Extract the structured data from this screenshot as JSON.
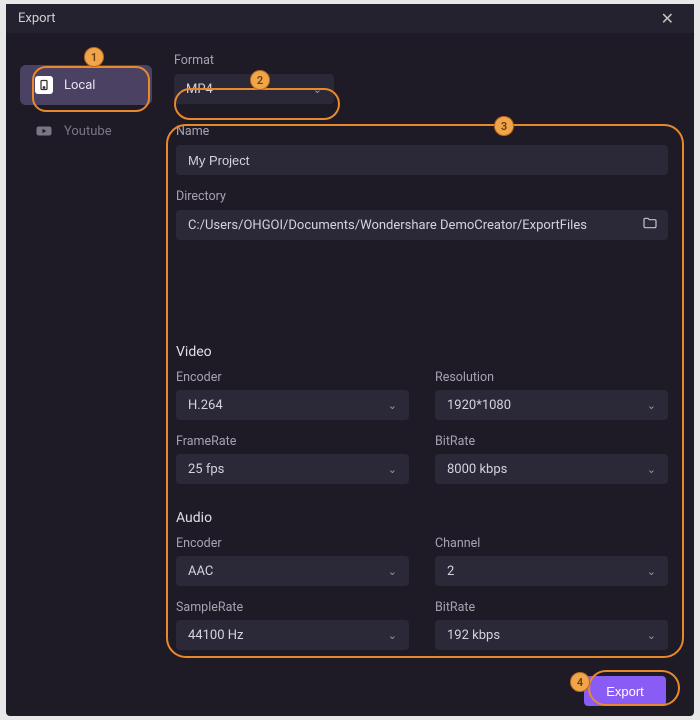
{
  "window": {
    "title": "Export"
  },
  "sidebar": {
    "items": [
      {
        "label": "Local",
        "active": true
      },
      {
        "label": "Youtube",
        "active": false
      }
    ]
  },
  "format": {
    "label": "Format",
    "value": "MP4"
  },
  "name": {
    "label": "Name",
    "value": "My Project"
  },
  "directory": {
    "label": "Directory",
    "value": "C:/Users/OHGOI/Documents/Wondershare DemoCreator/ExportFiles"
  },
  "video": {
    "title": "Video",
    "encoder": {
      "label": "Encoder",
      "value": "H.264"
    },
    "resolution": {
      "label": "Resolution",
      "value": "1920*1080"
    },
    "framerate": {
      "label": "FrameRate",
      "value": "25 fps"
    },
    "bitrate": {
      "label": "BitRate",
      "value": "8000 kbps"
    }
  },
  "audio": {
    "title": "Audio",
    "encoder": {
      "label": "Encoder",
      "value": "AAC"
    },
    "channel": {
      "label": "Channel",
      "value": "2"
    },
    "samplerate": {
      "label": "SampleRate",
      "value": "44100 Hz"
    },
    "bitrate": {
      "label": "BitRate",
      "value": "192 kbps"
    }
  },
  "footer": {
    "export": "Export"
  },
  "annotations": {
    "b1": "1",
    "b2": "2",
    "b3": "3",
    "b4": "4"
  }
}
